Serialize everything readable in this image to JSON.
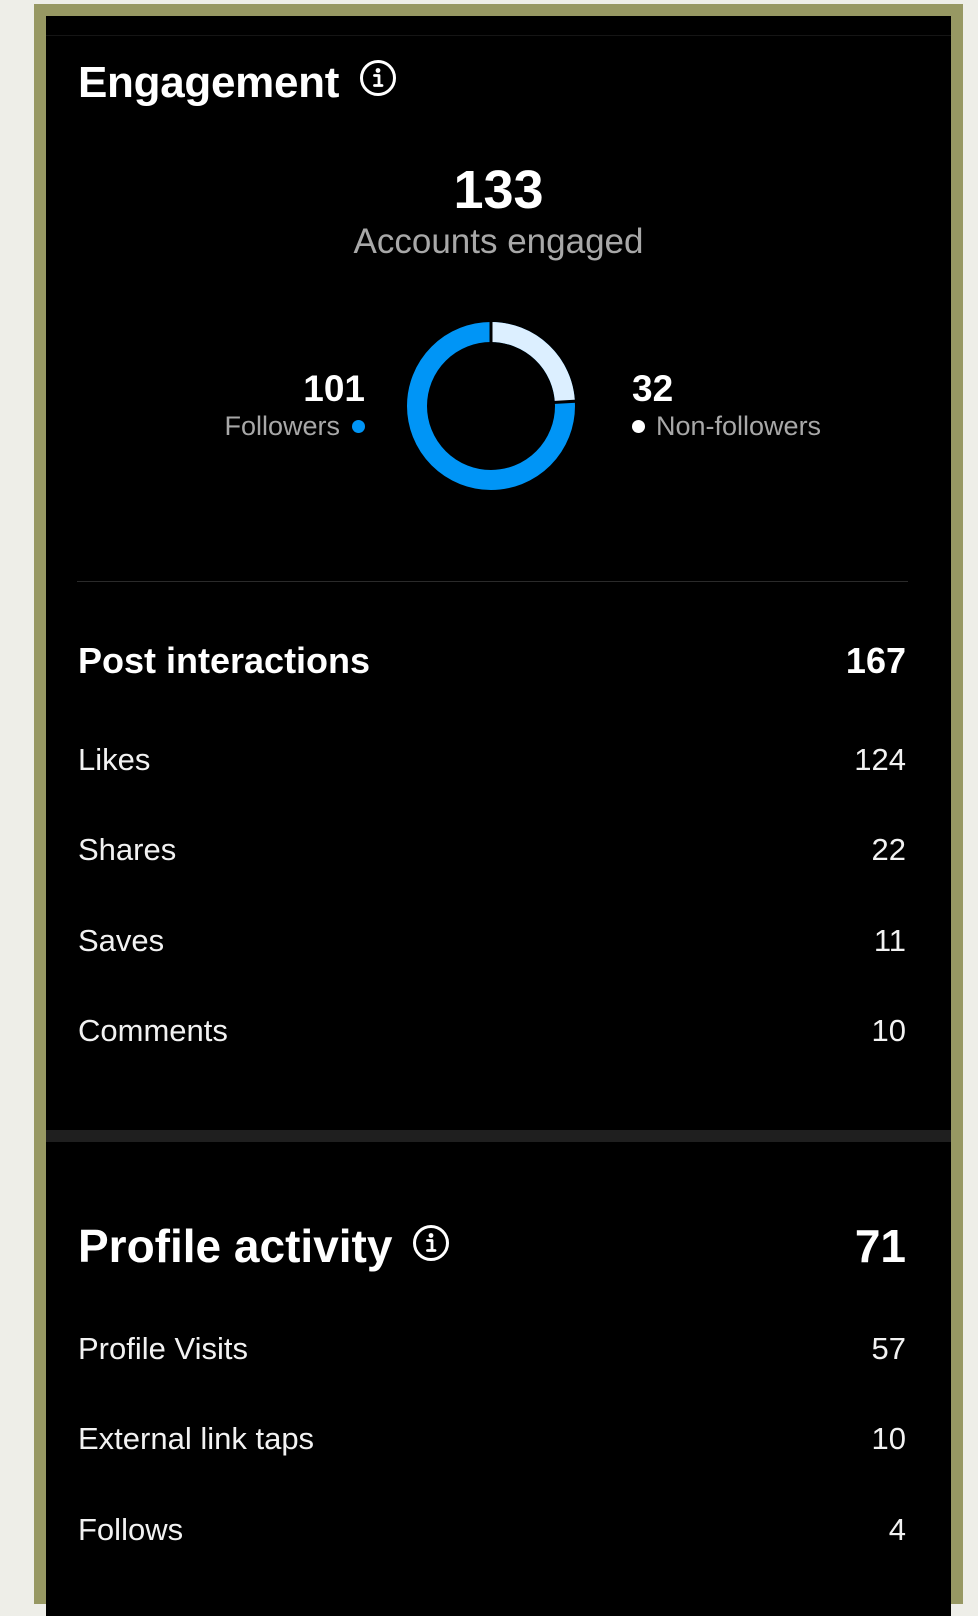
{
  "engagement": {
    "title": "Engagement",
    "info_icon": "info-icon",
    "accounts_engaged_value": "133",
    "accounts_engaged_label": "Accounts engaged",
    "followers_value": "101",
    "followers_label": "Followers",
    "non_followers_value": "32",
    "non_followers_label": "Non-followers",
    "followers_color": "#0095f6",
    "non_followers_color": "#dcefff",
    "followers_share": 0.759,
    "non_followers_share": 0.241
  },
  "post_interactions": {
    "title": "Post interactions",
    "total": "167",
    "rows": [
      {
        "label": "Likes",
        "value": "124"
      },
      {
        "label": "Shares",
        "value": "22"
      },
      {
        "label": "Saves",
        "value": "11"
      },
      {
        "label": "Comments",
        "value": "10"
      }
    ]
  },
  "profile_activity": {
    "title": "Profile activity",
    "info_icon": "info-icon",
    "total": "71",
    "rows": [
      {
        "label": "Profile Visits",
        "value": "57"
      },
      {
        "label": "External link taps",
        "value": "10"
      },
      {
        "label": "Follows",
        "value": "4"
      }
    ]
  }
}
